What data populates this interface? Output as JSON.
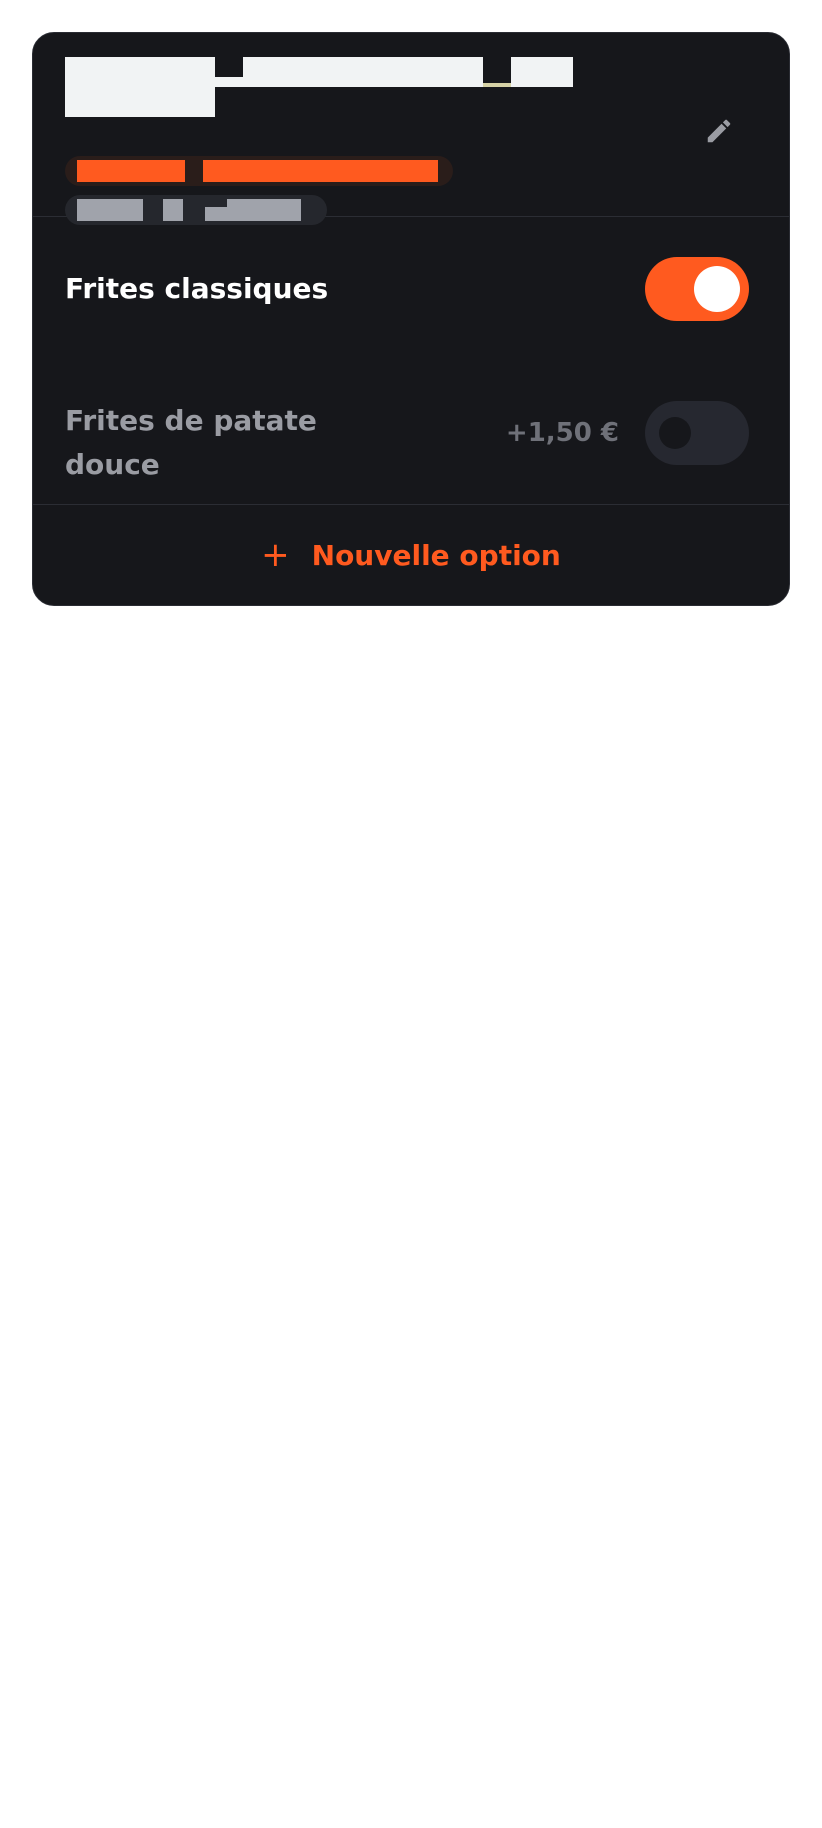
{
  "header": {
    "edit_icon": "pencil-icon"
  },
  "colors": {
    "accent": "#ff5a1f",
    "card_bg": "#16171b",
    "muted_text": "#9a9ca3"
  },
  "options": [
    {
      "label": "Frites classiques",
      "price": "",
      "enabled": true
    },
    {
      "label": "Frites de patate douce",
      "price": "+1,50 €",
      "enabled": false
    }
  ],
  "actions": {
    "add_option_label": "Nouvelle option",
    "add_icon": "plus-icon"
  }
}
